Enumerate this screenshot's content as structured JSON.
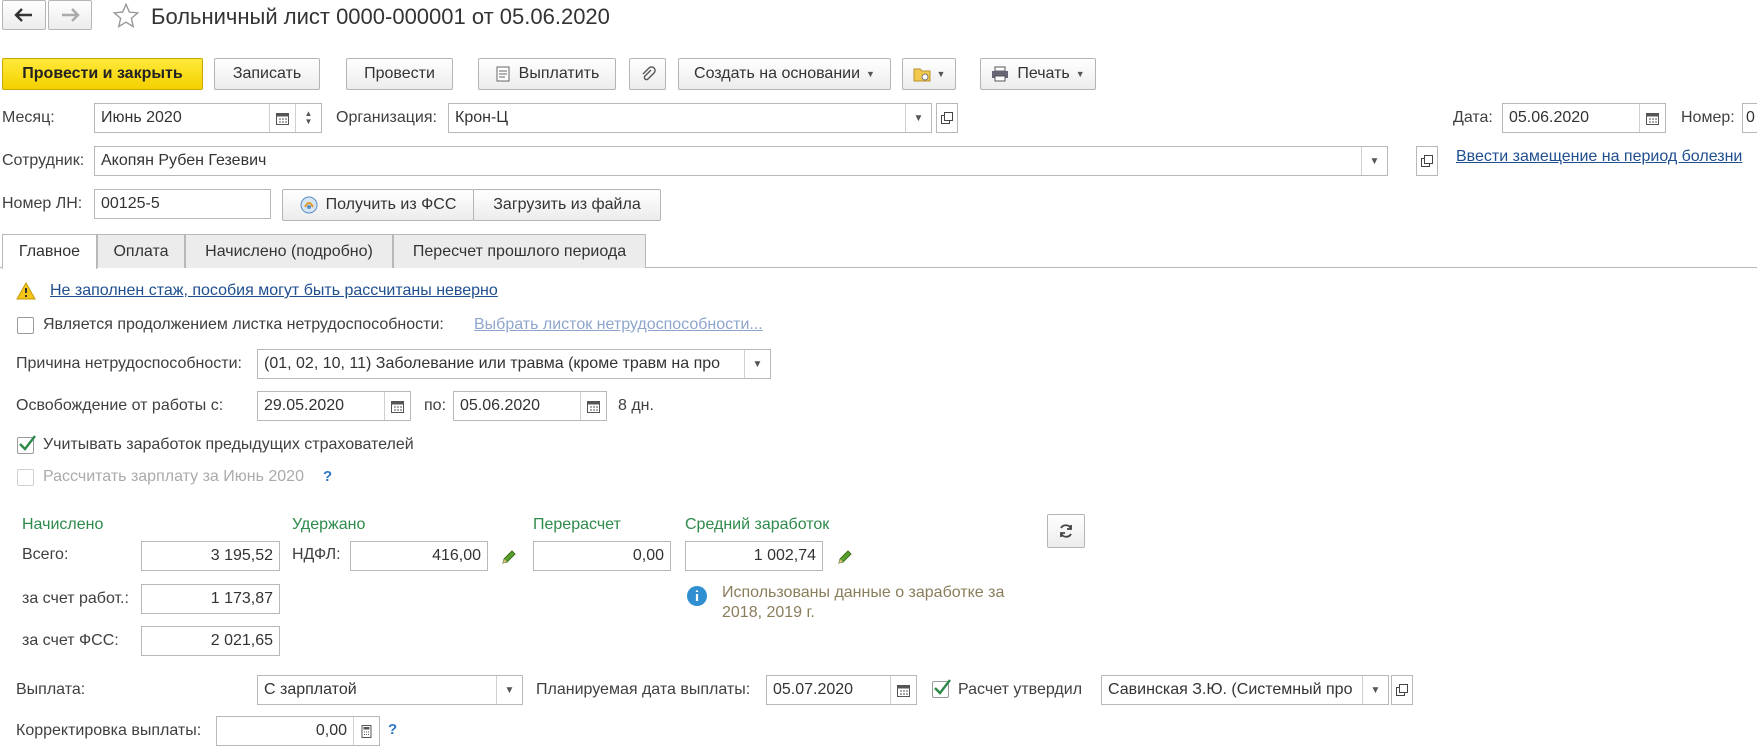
{
  "header": {
    "title": "Больничный лист 0000-000001 от 05.06.2020"
  },
  "toolbar": {
    "post_close": "Провести и закрыть",
    "save": "Записать",
    "post": "Провести",
    "pay": "Выплатить",
    "create_based": "Создать на основании",
    "print": "Печать"
  },
  "form": {
    "month_label": "Месяц:",
    "month_value": "Июнь 2020",
    "org_label": "Организация:",
    "org_value": "Крон-Ц",
    "date_label": "Дата:",
    "date_value": "05.06.2020",
    "number_label": "Номер:",
    "number_value": "0",
    "employee_label": "Сотрудник:",
    "employee_value": "Акопян Рубен Гезевич",
    "replace_link": "Ввести замещение на период болезни",
    "ln_label": "Номер ЛН:",
    "ln_value": "00125-5",
    "get_fss": "Получить из ФСС",
    "load_file": "Загрузить из файла"
  },
  "tabs": [
    "Главное",
    "Оплата",
    "Начислено (подробно)",
    "Пересчет прошлого периода"
  ],
  "main": {
    "warning_link": "Не заполнен стаж, пособия могут быть рассчитаны неверно",
    "continuation_label": "Является продолжением листка нетрудоспособности:",
    "continuation_link": "Выбрать листок нетрудоспособности...",
    "reason_label": "Причина нетрудоспособности:",
    "reason_value": "(01, 02, 10, 11) Заболевание или травма (кроме травм на про",
    "release_label": "Освобождение от работы с:",
    "release_from": "29.05.2020",
    "release_to_label": "по:",
    "release_to": "05.06.2020",
    "days": "8 дн.",
    "prev_insurers_label": "Учитывать заработок предыдущих страхователей",
    "calc_salary_label": "Рассчитать зарплату за Июнь 2020",
    "help_mark": "?"
  },
  "amounts": {
    "accrued_header": "Начислено",
    "withheld_header": "Удержано",
    "recalc_header": "Перерасчет",
    "avg_header": "Средний заработок",
    "total_label": "Всего:",
    "total_value": "3 195,52",
    "ndfl_label": "НДФЛ:",
    "ndfl_value": "416,00",
    "recalc_value": "0,00",
    "avg_value": "1 002,74",
    "employer_label": "за счет работ.:",
    "employer_value": "1 173,87",
    "fss_label": "за счет ФСС:",
    "fss_value": "2 021,65",
    "info_text_1": "Использованы данные о заработке за",
    "info_text_2": "2018,  2019 г."
  },
  "payment": {
    "label": "Выплата:",
    "value": "С зарплатой",
    "planned_date_label": "Планируемая дата выплаты:",
    "planned_date_value": "05.07.2020",
    "approved_label": "Расчет утвердил",
    "approved_value": "Савинская З.Ю. (Системный про",
    "correction_label": "Корректировка выплаты:",
    "correction_value": "0,00"
  },
  "colors": {
    "primary_button": "#f4d100",
    "section_header": "#2d8a4a",
    "link": "#1f4e8f"
  }
}
